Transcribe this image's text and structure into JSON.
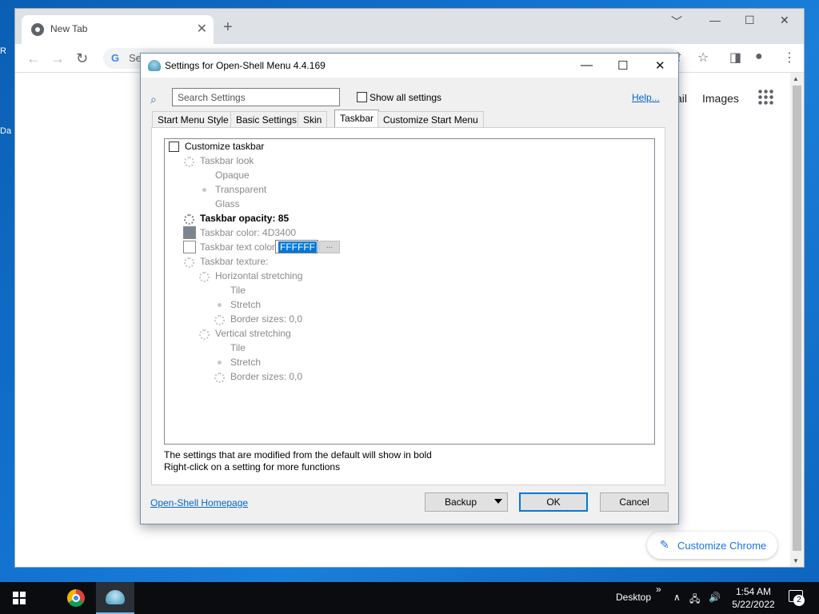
{
  "chrome": {
    "tab_title": "New Tab",
    "tab_close": "✕",
    "new_tab": "+",
    "win_min": "﹀",
    "win_minimize": "—",
    "win_max": "☐",
    "win_close": "✕",
    "back": "←",
    "forward": "→",
    "reload": "↻",
    "omni_g": "G",
    "omni_text": "Se",
    "share_icon": "⇪",
    "bookmark_icon": "☆",
    "sidepanel_icon": "◨",
    "profile_icon": "●",
    "menu_icon": "⋮",
    "gmail_fragment": "ail",
    "images_link": "Images",
    "customize_label": "Customize Chrome",
    "customize_icon": "✎"
  },
  "dialog": {
    "title": "Settings for Open-Shell Menu 4.4.169",
    "btn_minimize": "—",
    "btn_maximize": "☐",
    "btn_close": "✕",
    "search_icon": "magnifier-icon",
    "search_placeholder": "Search Settings",
    "show_all_label": "Show all settings",
    "help_link": "Help...",
    "tabs": [
      "Start Menu Style",
      "Basic Settings",
      "Skin",
      "Taskbar",
      "Customize Start Menu"
    ],
    "active_tab": "Taskbar",
    "tree": {
      "customize_taskbar": "Customize taskbar",
      "taskbar_look": "Taskbar look",
      "opaque": "Opaque",
      "transparent": "Transparent",
      "glass": "Glass",
      "opacity": "Taskbar opacity: 85",
      "color": "Taskbar color: 4D3400",
      "text_color": "Taskbar text color",
      "text_color_value": "FFFFFF",
      "dots_button": "...",
      "texture": "Taskbar texture:",
      "horizontal": "Horizontal stretching",
      "h_tile": "Tile",
      "h_stretch": "Stretch",
      "h_border": "Border sizes: 0,0",
      "vertical": "Vertical stretching",
      "v_tile": "Tile",
      "v_stretch": "Stretch",
      "v_border": "Border sizes: 0,0"
    },
    "swatch_taskbar_color": "#7a8590",
    "swatch_text_color": "#ffffff",
    "note_line1": "The settings that are modified from the default will show in bold",
    "note_line2": "Right-click on a setting for more functions",
    "homepage_link": "Open-Shell Homepage",
    "backup_label": "Backup",
    "ok_label": "OK",
    "cancel_label": "Cancel"
  },
  "taskbar": {
    "desktop_label": "Desktop",
    "chevron": "»",
    "tray_arrow": "∧",
    "network_icon": "🖧",
    "volume_icon": "🔊",
    "time": "1:54 AM",
    "date": "5/22/2022",
    "notification_count": "2"
  },
  "desktop": {
    "frag1": "R",
    "frag2": "Da"
  }
}
